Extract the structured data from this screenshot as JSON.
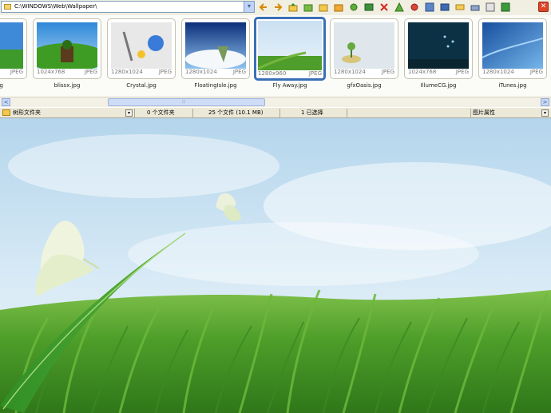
{
  "address": {
    "path": "C:\\WINDOWS\\Web\\Wallpaper\\"
  },
  "toolbar": {
    "icons": [
      "back-arrow",
      "forward-arrow",
      "folder-up",
      "open-folder",
      "new-folder",
      "folder-star",
      "refresh",
      "rotate",
      "delete",
      "filter",
      "print-red",
      "grid",
      "slideshow",
      "email",
      "print",
      "edit",
      "export"
    ],
    "close_label": "✕"
  },
  "thumbnails": [
    {
      "name": "",
      "dims": "",
      "format": "JPEG"
    },
    {
      "name": "blissx.jpg",
      "dims": "1024x768",
      "format": "JPEG"
    },
    {
      "name": "Crystal.jpg",
      "dims": "1280x1024",
      "format": "JPEG"
    },
    {
      "name": "FloatingIsle.jpg",
      "dims": "1280x1024",
      "format": "JPEG"
    },
    {
      "name": "Fly Away.jpg",
      "dims": "1280x960",
      "format": "JPEG",
      "selected": true
    },
    {
      "name": "gfxOasis.jpg",
      "dims": "1280x1024",
      "format": "JPEG"
    },
    {
      "name": "IllumeCG.jpg",
      "dims": "1024x768",
      "format": "JPEG"
    },
    {
      "name": "iTunes.jpg",
      "dims": "1280x1024",
      "format": "JPEG"
    }
  ],
  "leading_name_fragment": "g",
  "scrollbar": {
    "left": "<",
    "right": ">",
    "grip": "⦙⦙⦙"
  },
  "status": {
    "folder_tree": "树形文件夹",
    "folders": "0 个文件夹",
    "files": "25 个文件 (10.1 MB)",
    "selected": "1 已选择",
    "properties": "图片属性"
  },
  "colors": {
    "selection": "#3a6fb5",
    "sky": "#bcd9ee",
    "grass": "#4f9e2b"
  }
}
